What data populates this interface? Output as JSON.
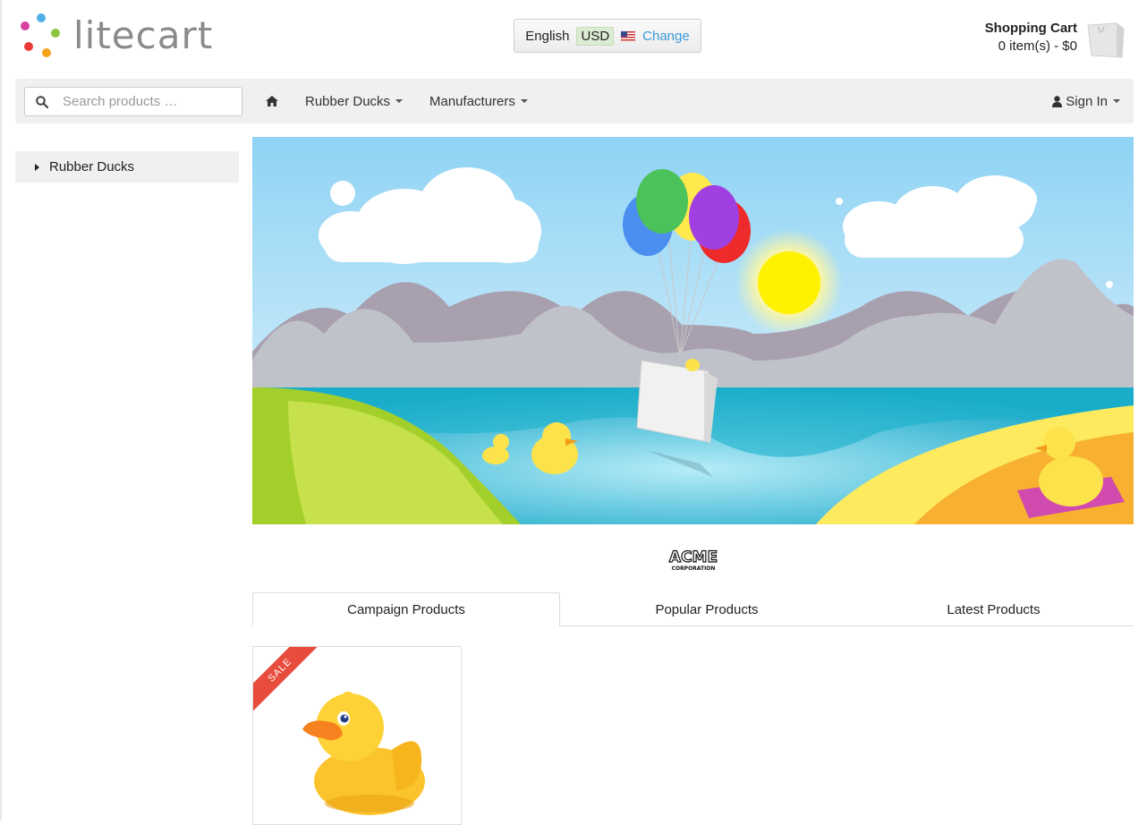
{
  "header": {
    "logo_text": "litecart",
    "region": {
      "language": "English",
      "currency": "USD",
      "change_label": "Change"
    },
    "cart": {
      "title": "Shopping Cart",
      "summary": "0 item(s) - $0"
    }
  },
  "navbar": {
    "search_placeholder": "Search products …",
    "items": [
      {
        "label": "Rubber Ducks"
      },
      {
        "label": "Manufacturers"
      }
    ],
    "sign_in_label": "Sign In"
  },
  "sidebar": {
    "categories": [
      {
        "label": "Rubber Ducks"
      }
    ]
  },
  "brand": {
    "logo_text": "ACME",
    "logo_subtext": "CORPORATION"
  },
  "tabs": [
    {
      "label": "Campaign Products",
      "active": true
    },
    {
      "label": "Popular Products",
      "active": false
    },
    {
      "label": "Latest Products",
      "active": false
    }
  ],
  "products": [
    {
      "badge": "SALE"
    }
  ],
  "colors": {
    "accent_link": "#3b9ad9",
    "sale_ribbon": "#e84c3d",
    "navbar_bg": "#f0f0f0"
  }
}
